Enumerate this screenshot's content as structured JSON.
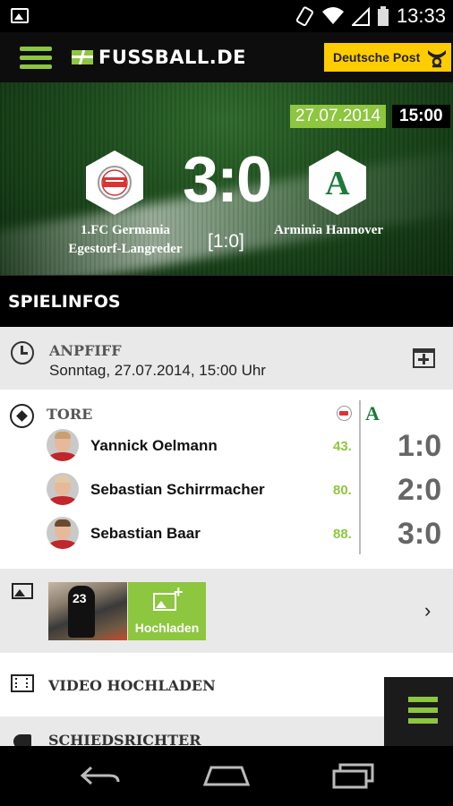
{
  "status_bar": {
    "time": "13:33",
    "icons": [
      "image-icon",
      "vibrate-icon",
      "wifi-icon",
      "signal-icon",
      "battery-icon"
    ]
  },
  "header": {
    "logo_text": "FUSSBALL.DE",
    "sponsor": "Deutsche Post",
    "colors": {
      "brand_green": "#8dc63f",
      "sponsor_yellow": "#ffcc00"
    }
  },
  "match": {
    "date": "27.07.2014",
    "time": "15:00",
    "home_team_line1": "1.FC Germania",
    "home_team_line2": "Egestorf-Langreder",
    "away_team": "Arminia Hannover",
    "away_logo_letter": "A",
    "score": "3:0",
    "halftime": "[1:0]"
  },
  "section": {
    "title": "SPIELINFOS"
  },
  "kickoff": {
    "label": "ANPFIFF",
    "value": "Sonntag, 27.07.2014, 15:00 Uhr"
  },
  "goals": {
    "label": "TORE",
    "away_logo_letter": "A",
    "items": [
      {
        "player": "Yannick Oelmann",
        "minute": "43.",
        "score": "1:0"
      },
      {
        "player": "Sebastian Schirrmacher",
        "minute": "80.",
        "score": "2:0"
      },
      {
        "player": "Sebastian Baar",
        "minute": "88.",
        "score": "3:0"
      }
    ]
  },
  "media": {
    "thumb_number": "23",
    "upload_label": "Hochladen",
    "chevron": "›"
  },
  "video": {
    "label": "VIDEO HOCHLADEN"
  },
  "referee": {
    "label": "SCHIEDSRICHTER"
  }
}
